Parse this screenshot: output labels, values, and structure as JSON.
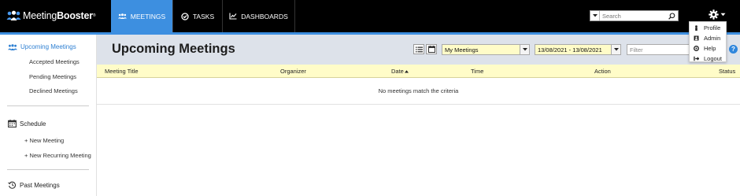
{
  "app": {
    "logo_bold": "Meeting",
    "logo_thin": "Booster",
    "logo_tm": "®"
  },
  "nav": {
    "tabs": [
      {
        "label": "MEETINGS",
        "active": true
      },
      {
        "label": "TASKS",
        "active": false
      },
      {
        "label": "DASHBOARDS",
        "active": false
      }
    ]
  },
  "search": {
    "placeholder": "Search",
    "value": ""
  },
  "user_menu": {
    "items": [
      {
        "label": "Profile",
        "icon": "person-icon"
      },
      {
        "label": "Admin",
        "icon": "admin-icon"
      },
      {
        "label": "Help",
        "icon": "help-icon"
      },
      {
        "label": "Logout",
        "icon": "logout-icon"
      }
    ]
  },
  "sidebar": {
    "upcoming": "Upcoming Meetings",
    "upcoming_items": [
      "Accepted Meetings",
      "Pending Meetings",
      "Declined Meetings"
    ],
    "schedule": "Schedule",
    "schedule_items": [
      "+ New Meeting",
      "+ New Recurring Meeting"
    ],
    "past": "Past Meetings"
  },
  "main": {
    "title": "Upcoming Meetings",
    "meeting_filter": "My Meetings",
    "date_range": "13/08/2021 - 13/08/2021",
    "filter_placeholder": "Filter",
    "help_label": "?",
    "columns": [
      "Meeting Title",
      "Organizer",
      "Date",
      "Time",
      "Action",
      "Status"
    ],
    "empty_message": "No meetings match the criteria"
  },
  "colors": {
    "brand_blue": "#3d8fe0",
    "topbar": "#000000",
    "header_band": "#dde2ea",
    "table_header": "#fffcc8"
  }
}
